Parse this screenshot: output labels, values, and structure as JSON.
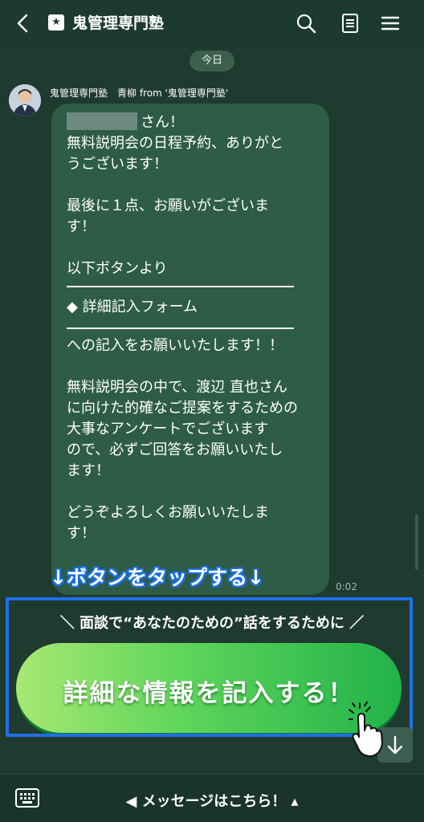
{
  "header": {
    "title": "鬼管理専門塾",
    "star": "★"
  },
  "chat": {
    "date_chip": "今日",
    "sender": "鬼管理専門塾　青柳 from '鬼管理専門塾'",
    "message_lines": [
      "さん！",
      "無料説明会の日程予約、ありがと",
      "うございます！",
      "",
      "最後に１点、お願いがございま",
      "す！",
      "",
      "以下ボタンより"
    ],
    "form_line": "◆ 詳細記入フォーム",
    "message_lines_2": [
      "への記入をお願いいたします！！",
      "",
      "無料説明会の中で、渡辺 直也さん",
      "に向けた的確なご提案をするための",
      "大事なアンケートでございます",
      "ので、必ずご回答をお願いいたし",
      "ます！",
      "",
      "どうぞよろしくお願いいたしま",
      "す！"
    ],
    "time": "0:02"
  },
  "annotation": {
    "tap_caption": "↓ボタンをタップする↓"
  },
  "rich_menu": {
    "slogan": "＼ 面談で“あなたのための”話をするために ／",
    "cta_label": "詳細な情報を記入する！"
  },
  "footer": {
    "menu_label": "◀ メッセージはこちら！ ▴"
  },
  "colors": {
    "background": "#1f3a2f",
    "bubble": "#2e5c47",
    "highlight": "#1f6fe8",
    "cta_start": "#a7e873",
    "cta_end": "#22b24a"
  }
}
